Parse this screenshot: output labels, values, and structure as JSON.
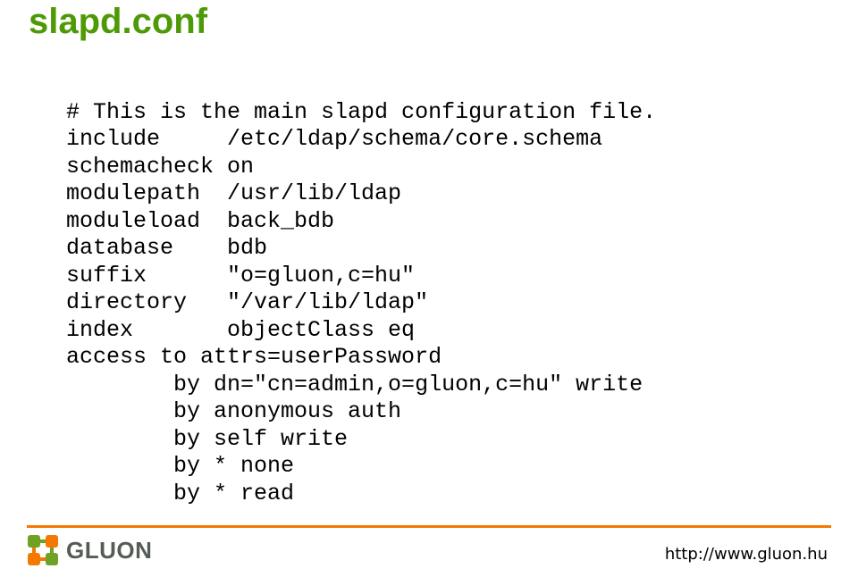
{
  "title": "slapd.conf",
  "code": {
    "lines": [
      "# This is the main slapd configuration file.",
      "include     /etc/ldap/schema/core.schema",
      "schemacheck on",
      "modulepath  /usr/lib/ldap",
      "moduleload  back_bdb",
      "database    bdb",
      "suffix      \"o=gluon,c=hu\"",
      "directory   \"/var/lib/ldap\"",
      "index       objectClass eq",
      "access to attrs=userPassword",
      "        by dn=\"cn=admin,o=gluon,c=hu\" write",
      "        by anonymous auth",
      "        by self write",
      "        by * none",
      "        by * read"
    ]
  },
  "footer": {
    "logo_text": "GLUON",
    "url": "http://www.gluon.hu"
  },
  "colors": {
    "title": "#4e9a06",
    "rule": "#f57900",
    "logo_mark_green": "#6fa224",
    "logo_mark_orange": "#f57900"
  }
}
